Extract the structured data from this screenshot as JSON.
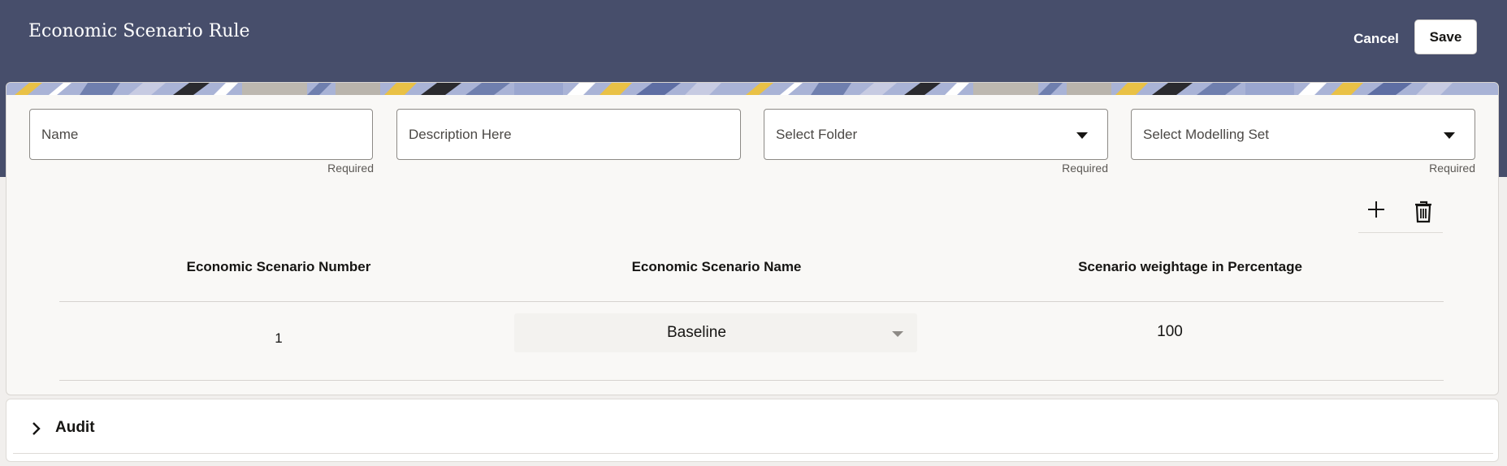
{
  "header": {
    "title": "Economic Scenario Rule",
    "cancel_label": "Cancel",
    "save_label": "Save"
  },
  "form": {
    "name": {
      "placeholder": "Name",
      "helper": "Required"
    },
    "description": {
      "placeholder": "Description Here"
    },
    "folder": {
      "placeholder": "Select Folder",
      "helper": "Required"
    },
    "modelling_set": {
      "placeholder": "Select Modelling Set",
      "helper": "Required"
    }
  },
  "toolbar": {
    "add_icon": "plus-icon",
    "delete_icon": "trash-icon"
  },
  "table": {
    "columns": [
      "Economic Scenario Number",
      "Economic Scenario Name",
      "Scenario weightage in Percentage"
    ],
    "rows": [
      {
        "number": "1",
        "name": "Baseline",
        "weightage": "100"
      }
    ]
  },
  "audit": {
    "label": "Audit",
    "icon": "chevron-right-icon"
  },
  "colors": {
    "header_bg": "#474e6b",
    "card_bg": "#f9f8f6",
    "accent_yellow": "#e9c146"
  }
}
